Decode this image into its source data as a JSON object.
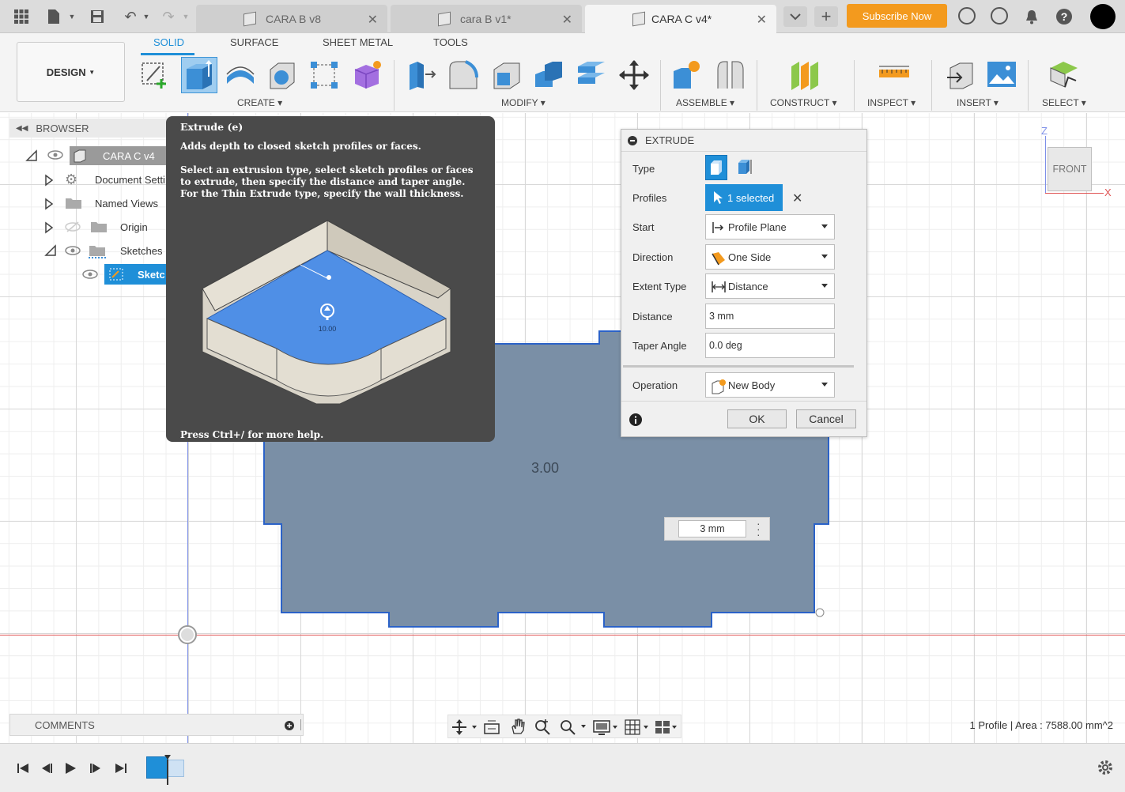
{
  "document_tabs": [
    {
      "label": "CARA B v8",
      "active": false
    },
    {
      "label": "cara B v1*",
      "active": false
    },
    {
      "label": "CARA C v4*",
      "active": true
    }
  ],
  "subscribe_label": "Subscribe Now",
  "toolbar": {
    "design_label": "DESIGN",
    "workspace_tabs": [
      "SOLID",
      "SURFACE",
      "SHEET METAL",
      "TOOLS"
    ],
    "groups": [
      "CREATE",
      "MODIFY",
      "ASSEMBLE",
      "CONSTRUCT",
      "INSPECT",
      "INSERT",
      "SELECT"
    ]
  },
  "browser": {
    "title": "BROWSER",
    "items": [
      {
        "label": "CARA C v4"
      },
      {
        "label": "Document Setti"
      },
      {
        "label": "Named Views"
      },
      {
        "label": "Origin"
      },
      {
        "label": "Sketches"
      },
      {
        "label": "Sketc"
      }
    ]
  },
  "tooltip": {
    "title": "Extrude (e)",
    "summary": "Adds depth to closed sketch profiles or faces.",
    "description": "Select an extrusion type, select sketch profiles or faces to extrude, then specify the distance and taper angle. For the Thin Extrude type, specify the wall thickness.",
    "illustration_value": "10.00",
    "footer": "Press Ctrl+/ for more help."
  },
  "extrude": {
    "title": "EXTRUDE",
    "labels": {
      "type": "Type",
      "profiles": "Profiles",
      "start": "Start",
      "direction": "Direction",
      "extent_type": "Extent Type",
      "distance": "Distance",
      "taper_angle": "Taper Angle",
      "operation": "Operation"
    },
    "profiles_value": "1 selected",
    "start_value": "Profile Plane",
    "direction_value": "One Side",
    "extent_type_value": "Distance",
    "distance_value": "3 mm",
    "taper_angle_value": "0.0 deg",
    "operation_value": "New Body",
    "ok_label": "OK",
    "cancel_label": "Cancel"
  },
  "viewcube": {
    "face": "FRONT",
    "axis_z": "Z",
    "axis_x": "X"
  },
  "canvas": {
    "dimension_label": "3.00",
    "distance_input": "3 mm"
  },
  "comments_label": "COMMENTS",
  "status_text": "1 Profile | Area : 7588.00 mm^2",
  "colors": {
    "accent": "#1f8fd8",
    "profile_fill": "#7a8fa6",
    "subscribe": "#f39a1e",
    "tooltip_bg": "#4a4a4a"
  }
}
